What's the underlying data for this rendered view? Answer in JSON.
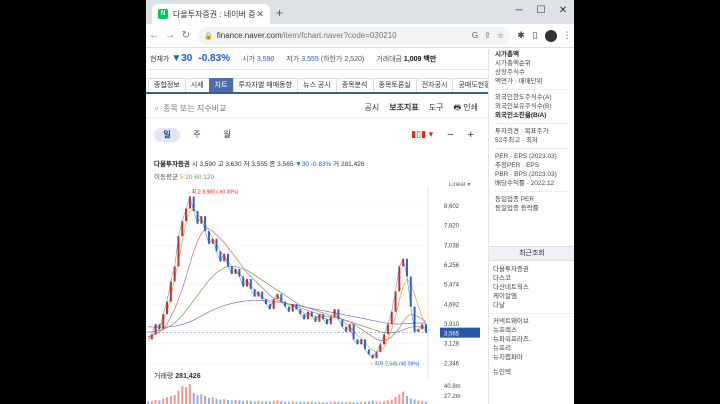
{
  "browser": {
    "tab_title": "다올투자증권 : 네이버 증권",
    "favicon": "N",
    "url_main": "finance.naver.com",
    "url_path": "/item/fchart.naver?code=030210",
    "new_tab": "+",
    "min": "─",
    "max": "☐",
    "close": "✕"
  },
  "stock_header": {
    "label": "현재가",
    "price": "▼30",
    "change_rate": "-0.83%",
    "high_label": "시가",
    "high_value": "3,590",
    "low_label": "저가",
    "low_value": "3,555",
    "low_limit": "(하한가 2,520)",
    "trade_label": "거래대금",
    "trade_value": "1,009 백만"
  },
  "menu": {
    "items": [
      "종합정보",
      "시세",
      "차트",
      "투자자별 매매동향",
      "뉴스 공시",
      "종목분석",
      "종목토론실",
      "전자공시",
      "공매도현황"
    ],
    "active_index": 2
  },
  "search": {
    "placeholder": "종목 또는 지수비교",
    "tools": [
      "공시",
      "보조지표",
      "도구",
      "인쇄"
    ]
  },
  "period": {
    "options": [
      "일",
      "주",
      "월"
    ],
    "active": "일"
  },
  "info": {
    "name": "다올투자증권",
    "open_label": "시",
    "open": "3,590",
    "high_label": "고",
    "high": "3,630",
    "low_label": "저",
    "low": "3,555",
    "close_label": "종",
    "close": "3,565",
    "change": "▼30 -0.83%",
    "volume_label": "거",
    "volume": "281,426"
  },
  "ma": {
    "label": "이동평균",
    "periods": [
      "5",
      "20",
      "60",
      "120"
    ]
  },
  "volume_label": "거래량",
  "volume_value": "281,426",
  "chart_data": {
    "type": "line",
    "scale_label": "Linear",
    "y_ticks": [
      8602,
      7820,
      7038,
      6256,
      5474,
      4692,
      3910,
      3128,
      2346
    ],
    "ylim": [
      2000,
      9000
    ],
    "current_price": 3565,
    "current_label": "3,565",
    "max_annotation": "최고 8,980 (-60.30%)",
    "min_annotation": "최저 2,545 (40.08%)",
    "volume_ticks": [
      "40.8m",
      "27.2m"
    ],
    "series": [
      {
        "name": "price",
        "values": [
          3300,
          3500,
          3900,
          3700,
          4300,
          4800,
          5600,
          6200,
          7400,
          8000,
          8500,
          8980,
          8400,
          7900,
          8200,
          7600,
          7100,
          7300,
          6800,
          6400,
          6700,
          6200,
          5900,
          6100,
          5800,
          5400,
          5700,
          5300,
          5000,
          5200,
          4900,
          4700,
          4500,
          4900,
          5100,
          4800,
          4600,
          4400,
          4700,
          4500,
          4300,
          4100,
          4400,
          4200,
          4000,
          4300,
          4100,
          3900,
          4200,
          4500,
          4100,
          3800,
          3600,
          3900,
          3300,
          3100,
          3300,
          2900,
          2700,
          2545,
          2800,
          3100,
          3500,
          3900,
          4400,
          5200,
          6200,
          6500,
          5800,
          4600,
          3600,
          3700,
          3900,
          3565
        ]
      },
      {
        "name": "MA5",
        "values": [
          3200,
          3400,
          3600,
          3750,
          4000,
          4400,
          5000,
          5700,
          6400,
          7200,
          7900,
          8400,
          8500,
          8300,
          8100,
          7900,
          7600,
          7300,
          7100,
          6800,
          6600,
          6400,
          6200,
          6050,
          5900,
          5700,
          5600,
          5450,
          5250,
          5100,
          5000,
          4850,
          4750,
          4750,
          4800,
          4800,
          4750,
          4650,
          4600,
          4550,
          4450,
          4350,
          4300,
          4250,
          4200,
          4200,
          4150,
          4100,
          4100,
          4200,
          4200,
          4100,
          3900,
          3800,
          3650,
          3450,
          3350,
          3200,
          3000,
          2850,
          2800,
          2850,
          3000,
          3300,
          3700,
          4200,
          4850,
          5400,
          5700,
          5500,
          5100,
          4600,
          4200,
          3800
        ]
      },
      {
        "name": "MA20",
        "values": [
          3400,
          3450,
          3500,
          3600,
          3700,
          3900,
          4200,
          4500,
          4900,
          5300,
          5800,
          6300,
          6800,
          7200,
          7500,
          7700,
          7700,
          7600,
          7450,
          7300,
          7150,
          6950,
          6750,
          6550,
          6350,
          6150,
          5950,
          5800,
          5650,
          5500,
          5350,
          5200,
          5050,
          4950,
          4850,
          4800,
          4750,
          4700,
          4650,
          4600,
          4550,
          4500,
          4450,
          4400,
          4350,
          4300,
          4250,
          4200,
          4200,
          4150,
          4150,
          4100,
          4050,
          4000,
          3900,
          3800,
          3700,
          3600,
          3500,
          3400,
          3300,
          3250,
          3250,
          3300,
          3400,
          3550,
          3750,
          4000,
          4200,
          4300,
          4250,
          4200,
          4100,
          4000
        ]
      },
      {
        "name": "MA60",
        "values": [
          3600,
          3600,
          3620,
          3650,
          3700,
          3760,
          3840,
          3950,
          4100,
          4250,
          4450,
          4650,
          4850,
          5050,
          5250,
          5450,
          5650,
          5800,
          5950,
          6050,
          6150,
          6200,
          6200,
          6200,
          6150,
          6100,
          6050,
          5950,
          5850,
          5750,
          5650,
          5550,
          5450,
          5350,
          5250,
          5150,
          5050,
          4950,
          4850,
          4750,
          4650,
          4600,
          4550,
          4500,
          4450,
          4400,
          4350,
          4300,
          4250,
          4200,
          4150,
          4100,
          4050,
          4000,
          3950,
          3900,
          3850,
          3800,
          3750,
          3700,
          3650,
          3600,
          3580,
          3560,
          3560,
          3580,
          3620,
          3680,
          3740,
          3780,
          3800,
          3800,
          3790,
          3780
        ]
      },
      {
        "name": "MA120",
        "values": [
          3800,
          3790,
          3780,
          3780,
          3780,
          3790,
          3800,
          3820,
          3850,
          3890,
          3940,
          4000,
          4070,
          4150,
          4230,
          4310,
          4390,
          4460,
          4530,
          4590,
          4640,
          4690,
          4730,
          4760,
          4790,
          4810,
          4830,
          4840,
          4850,
          4850,
          4850,
          4840,
          4830,
          4810,
          4790,
          4770,
          4740,
          4710,
          4680,
          4650,
          4620,
          4590,
          4560,
          4530,
          4500,
          4470,
          4440,
          4410,
          4380,
          4350,
          4320,
          4290,
          4260,
          4230,
          4200,
          4170,
          4140,
          4110,
          4080,
          4050,
          4020,
          3990,
          3960,
          3940,
          3920,
          3910,
          3910,
          3920,
          3930,
          3940,
          3950,
          3950,
          3950,
          3950
        ]
      }
    ],
    "volume": [
      6,
      7,
      9,
      8,
      12,
      15,
      18,
      20,
      30,
      40,
      38,
      45,
      25,
      20,
      22,
      18,
      14,
      15,
      12,
      10,
      11,
      9,
      8,
      9,
      8,
      7,
      8,
      7,
      6,
      7,
      6,
      6,
      5,
      7,
      8,
      6,
      5,
      5,
      6,
      5,
      5,
      4,
      5,
      5,
      4,
      5,
      4,
      4,
      5,
      6,
      5,
      4,
      4,
      5,
      4,
      4,
      5,
      5,
      6,
      8,
      6,
      5,
      6,
      8,
      10,
      16,
      22,
      28,
      18,
      12,
      10,
      8,
      7,
      5
    ],
    "colors": {
      "price": "#2d63c8",
      "up": "#d52b1e",
      "ma5": "#e4a43a",
      "ma20": "#d36a77",
      "ma60": "#68a05a",
      "ma120": "#7575c7"
    }
  },
  "right_panel": {
    "group1": [
      "시가총액",
      "시가총액순위",
      "상장주식수",
      "액면가 · 매매단위"
    ],
    "group2": [
      "외국인한도주식수(A)",
      "외국인보유주식수(B)",
      "외국인소진율(B/A)"
    ],
    "group3": [
      "투자의견 · 목표주가",
      "52주최고 · 최저"
    ],
    "group4": [
      "PER · EPS (2023.03)",
      "추정PER · EPS",
      "PBR · BPS (2023.03)",
      "배당수익률 · 2022.12"
    ],
    "group5": [
      "동일업종 PER",
      "동일업종 등락률"
    ],
    "recent_header": "최근조회",
    "recent": [
      "다올투자증권",
      "다스코",
      "다산네트웍스",
      "케이알엠",
      "다날",
      "커넥트웨이브",
      "뉴프렉스",
      "뉴파워프라즈..",
      "뉴프리",
      "뉴지랩파마",
      "뉴인텍"
    ]
  }
}
